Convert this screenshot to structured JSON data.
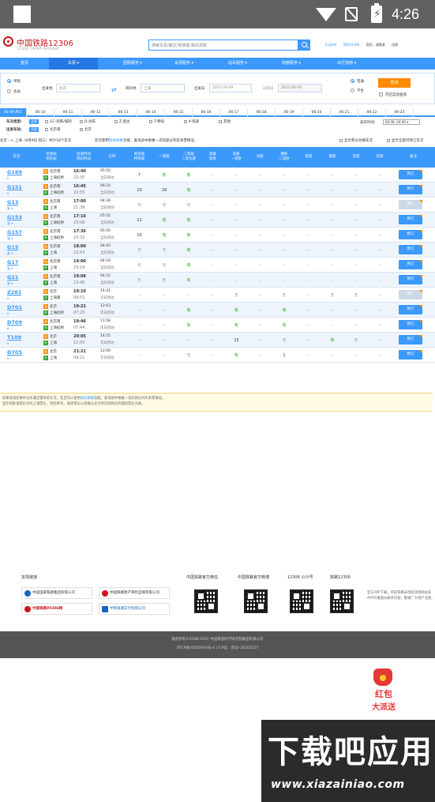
{
  "status_bar": {
    "time": "4:26"
  },
  "header": {
    "logo_cn": "中国铁路12306",
    "logo_en": "12306 CHINA RAILWAY",
    "search_placeholder": "搜索车票/餐饮/常旅客/相关规章",
    "links": [
      "English",
      "我的12306",
      "您好，请登录",
      "注册"
    ]
  },
  "nav": [
    "首页",
    "车票",
    "团购服务",
    "会员服务",
    "站车服务",
    "商旅服务",
    "出行指南"
  ],
  "query": {
    "trip_types": [
      "单程",
      "往返"
    ],
    "from_label": "出发地",
    "from_value": "北京",
    "to_label": "目的地",
    "to_value": "上海",
    "depart_label": "出发日",
    "depart_value": "2021-06-09",
    "return_label": "返程日",
    "return_value": "2021-06-09",
    "passenger_types": [
      "普通",
      "学生"
    ],
    "search_button": "查询",
    "auto_query": "开启自动查询"
  },
  "dates": [
    "06-09 周三",
    "06-10",
    "06-11",
    "06-12",
    "06-13",
    "06-14",
    "06-15",
    "06-16",
    "06-17",
    "06-18",
    "06-19",
    "06-20",
    "06-21",
    "06-22",
    "06-23"
  ],
  "filters": {
    "type_label": "车次类型:",
    "all_tag": "全部",
    "types": [
      "GC-高铁/城际",
      "D-动车",
      "Z-直达",
      "T-特快",
      "K-快速",
      "其他"
    ],
    "depart_station_label": "出发车站:",
    "stations": [
      "北京南",
      "北京"
    ],
    "time_label": "发车时间:",
    "time_value": "00:00--24:00"
  },
  "summary": {
    "route": "北京 --> 上海（6月9日 周三）共计18个车次",
    "note_pre": "您可使用",
    "note_link": "接续换乘",
    "note_post": "功能，查询途中换乘一次的部分列车余票情况。",
    "opt1": "显示积分兑换车次",
    "opt2": "显示全部可预订车次"
  },
  "table_headers": {
    "train": "车次",
    "stations": "出发站\n到达站",
    "times": "出发时间\n到达时间",
    "duration": "历时",
    "business": "商务座\n特等座",
    "first": "一等座",
    "second": "二等座\n二等包座",
    "high_soft": "高级\n软卧",
    "soft_sleeper": "软卧\n一等卧",
    "moving_sleeper": "动卧",
    "hard_sleeper": "硬卧\n二等卧",
    "soft_seat": "软座",
    "hard_seat": "硬座",
    "standing": "无座",
    "other": "其他",
    "remark": "备注"
  },
  "trains": [
    {
      "no": "G169",
      "sub": "",
      "dep": "北京南",
      "arr": "上海虹桥",
      "dep_t": "16:40",
      "arr_t": "22:35",
      "dur": "05:55",
      "dur_sub": "当日到达",
      "seats": [
        "7",
        "有",
        "有",
        "--",
        "--",
        "--",
        "--",
        "--",
        "--",
        "--",
        "--"
      ],
      "book": "预订",
      "enabled": true
    },
    {
      "no": "G151",
      "sub": "",
      "dep": "北京南",
      "arr": "上海虹桥",
      "dep_t": "16:45",
      "arr_t": "22:55",
      "dur": "06:10",
      "dur_sub": "当日到达",
      "seats": [
        "10",
        "18",
        "有",
        "--",
        "--",
        "--",
        "--",
        "--",
        "--",
        "--",
        "--"
      ],
      "book": "预订",
      "enabled": true
    },
    {
      "no": "G13",
      "sub": "复",
      "dep": "北京南",
      "arr": "上海",
      "dep_t": "17:00",
      "arr_t": "21:36",
      "dur": "04:36",
      "dur_sub": "当日到达",
      "seats": [
        "无",
        "无",
        "无",
        "--",
        "--",
        "--",
        "--",
        "--",
        "--",
        "--",
        "--"
      ],
      "book": "预订",
      "enabled": false
    },
    {
      "no": "G153",
      "sub": "复",
      "dep": "北京南",
      "arr": "上海虹桥",
      "dep_t": "17:16",
      "arr_t": "23:08",
      "dur": "05:52",
      "dur_sub": "当日到达",
      "seats": [
        "11",
        "有",
        "有",
        "--",
        "--",
        "--",
        "--",
        "--",
        "--",
        "--",
        "--"
      ],
      "book": "预订",
      "enabled": true
    },
    {
      "no": "G157",
      "sub": "复",
      "dep": "北京南",
      "arr": "上海虹桥",
      "dep_t": "17:36",
      "arr_t": "23:32",
      "dur": "05:56",
      "dur_sub": "当日到达",
      "seats": [
        "10",
        "有",
        "有",
        "--",
        "--",
        "--",
        "--",
        "--",
        "--",
        "--",
        "--"
      ],
      "book": "预订",
      "enabled": true
    },
    {
      "no": "G15",
      "sub": "复",
      "dep": "北京南",
      "arr": "上海",
      "dep_t": "18:00",
      "arr_t": "22:43",
      "dur": "04:43",
      "dur_sub": "当日到达",
      "seats": [
        "无",
        "无",
        "有",
        "--",
        "--",
        "--",
        "--",
        "--",
        "--",
        "--",
        "--"
      ],
      "book": "预订",
      "enabled": true
    },
    {
      "no": "G17",
      "sub": "复",
      "dep": "北京南",
      "arr": "上海",
      "dep_t": "19:00",
      "arr_t": "23:18",
      "dur": "04:18",
      "dur_sub": "当日到达",
      "seats": [
        "无",
        "无",
        "有",
        "--",
        "--",
        "--",
        "--",
        "--",
        "--",
        "--",
        "--"
      ],
      "book": "预订",
      "enabled": true
    },
    {
      "no": "G21",
      "sub": "复",
      "dep": "北京南",
      "arr": "上海",
      "dep_t": "19:08",
      "arr_t": "23:40",
      "dur": "04:32",
      "dur_sub": "当日到达",
      "seats": [
        "无",
        "无",
        "有",
        "--",
        "--",
        "--",
        "--",
        "--",
        "--",
        "--",
        "--"
      ],
      "book": "预订",
      "enabled": true
    },
    {
      "no": "Z281",
      "sub": "",
      "dep": "北京",
      "arr": "上海南",
      "dep_t": "19:10",
      "arr_t": "09:51",
      "dur": "14:41",
      "dur_sub": "次日到达",
      "seats": [
        "--",
        "--",
        "--",
        "--",
        "无",
        "--",
        "无",
        "--",
        "无",
        "无",
        "--"
      ],
      "book": "预订",
      "enabled": false
    },
    {
      "no": "D701",
      "sub": "",
      "dep": "北京",
      "arr": "上海虹桥",
      "dep_t": "19:22",
      "arr_t": "07:25",
      "dur": "12:03",
      "dur_sub": "次日到达",
      "seats": [
        "--",
        "--",
        "有",
        "--",
        "有",
        "--",
        "有",
        "--",
        "--",
        "--",
        "--"
      ],
      "book": "预订",
      "enabled": true
    },
    {
      "no": "D709",
      "sub": "",
      "dep": "北京南",
      "arr": "上海虹桥",
      "dep_t": "19:46",
      "arr_t": "07:44",
      "dur": "11:58",
      "dur_sub": "次日到达",
      "seats": [
        "--",
        "--",
        "有",
        "--",
        "有",
        "--",
        "有",
        "--",
        "--",
        "--",
        "--"
      ],
      "book": "预订",
      "enabled": true
    },
    {
      "no": "T109",
      "sub": "",
      "dep": "北京",
      "arr": "上海",
      "dep_t": "20:05",
      "arr_t": "11:00",
      "dur": "14:55",
      "dur_sub": "次日到达",
      "seats": [
        "--",
        "--",
        "--",
        "--",
        "15",
        "--",
        "无",
        "--",
        "有",
        "无",
        "--"
      ],
      "book": "预订",
      "enabled": true
    },
    {
      "no": "D705",
      "sub": "",
      "dep": "北京",
      "arr": "上海",
      "dep_t": "21:21",
      "arr_t": "09:21",
      "dur": "12:00",
      "dur_sub": "次日到达",
      "seats": [
        "--",
        "--",
        "无",
        "--",
        "有",
        "--",
        "1",
        "--",
        "--",
        "--",
        "--"
      ],
      "book": "预订",
      "enabled": true
    }
  ],
  "tip": {
    "line1_pre": "如果查询结果中没有满足需求的车次，您还可以使用",
    "line1_link": "接续换乘",
    "line1_post": "功能，查询途中换乘一次的部分列车余票情况。",
    "line2": "显示的卧铺票价均为上铺票价，供您参考。具体票价以您确认支付时实际购买的铺别票价为准。"
  },
  "footer": {
    "friends_title": "友情链接",
    "friend_links": [
      "中国国家铁路集团有限公司",
      "中国铁路财产保险自保有限公司",
      "中国铁路95306网",
      "中铁银通支付有限公司"
    ],
    "qr_titles": [
      "中国铁路官方微信",
      "中国铁路官方微博",
      "12306 公众号",
      "铁路12306"
    ],
    "app_note": "官方APP下载，目前铁路未授权其他网站或APP开展类似服务内容，敬请广大用户注意。",
    "copyright": "版权所有©2008-2021   中国铁道科学研究院集团有限公司",
    "icp": "京ICP备05020493号-4  |  ICP证：京B2-20202537"
  },
  "promo": {
    "line1": "红包",
    "line2": "大派送"
  },
  "watermark": {
    "big": "下载吧应用",
    "url": "www.xiazainiao.com"
  },
  "colors": {
    "primary": "#3b99fc",
    "accent": "#ff8a00",
    "brand": "#c8161d",
    "available": "#27a527"
  }
}
